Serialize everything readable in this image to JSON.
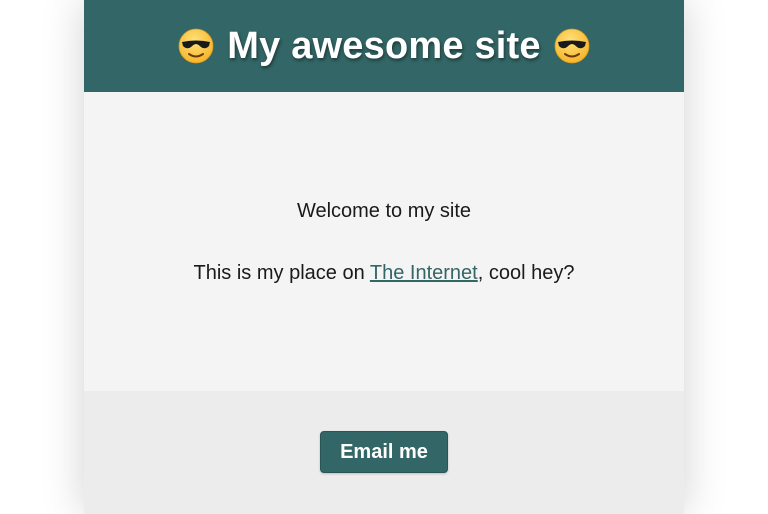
{
  "header": {
    "title": "My awesome site",
    "emoji_left": "smiling-face-with-sunglasses-icon",
    "emoji_right": "smiling-face-with-sunglasses-icon"
  },
  "main": {
    "welcome": "Welcome to my site",
    "intro_before_link": "This is my place on ",
    "link_text": "The Internet",
    "intro_after_link": ", cool hey?"
  },
  "footer": {
    "button_label": "Email me"
  },
  "colors": {
    "brand": "#336666",
    "main_bg": "#f4f4f4",
    "footer_bg": "#ececec"
  }
}
